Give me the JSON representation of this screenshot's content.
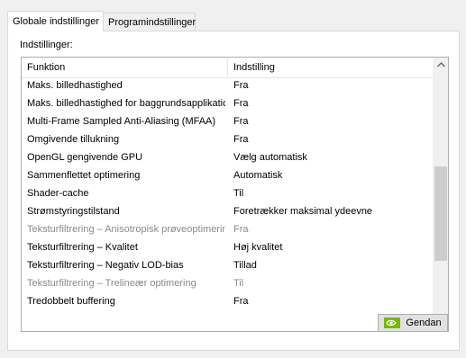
{
  "tabs": [
    {
      "label": "Globale indstillinger",
      "active": true
    },
    {
      "label": "Programindstillinger",
      "active": false
    }
  ],
  "settings_label": "Indstillinger:",
  "table": {
    "columns": [
      "Funktion",
      "Indstilling"
    ],
    "rows": [
      {
        "function": "Maks. billedhastighed",
        "value": "Fra",
        "disabled": false
      },
      {
        "function": "Maks. billedhastighed for baggrundsapplikationer",
        "value": "Fra",
        "disabled": false
      },
      {
        "function": "Multi-Frame Sampled Anti-Aliasing (MFAA)",
        "value": "Fra",
        "disabled": false
      },
      {
        "function": "Omgivende tillukning",
        "value": "Fra",
        "disabled": false
      },
      {
        "function": "OpenGL gengivende GPU",
        "value": "Vælg automatisk",
        "disabled": false
      },
      {
        "function": "Sammenflettet optimering",
        "value": "Automatisk",
        "disabled": false
      },
      {
        "function": "Shader-cache",
        "value": "Til",
        "disabled": false
      },
      {
        "function": "Strømstyringstilstand",
        "value": "Foretrækker maksimal ydeevne",
        "disabled": false
      },
      {
        "function": "Teksturfiltrering – Anisotropisk prøveoptimering",
        "value": "Fra",
        "disabled": true
      },
      {
        "function": "Teksturfiltrering – Kvalitet",
        "value": "Høj kvalitet",
        "disabled": false
      },
      {
        "function": "Teksturfiltrering – Negativ LOD-bias",
        "value": "Tillad",
        "disabled": false
      },
      {
        "function": "Teksturfiltrering – Trelineær optimering",
        "value": "Til",
        "disabled": true
      },
      {
        "function": "Tredobbelt buffering",
        "value": "Fra",
        "disabled": false
      }
    ]
  },
  "restore_button": {
    "label": "Gendan",
    "icon": "nvidia-logo-icon"
  },
  "colors": {
    "background": "#f0f0f0",
    "disabled_text": "#8a8a8a",
    "scroll_thumb": "#cdcdcd",
    "nvidia_green": "#76b900"
  }
}
